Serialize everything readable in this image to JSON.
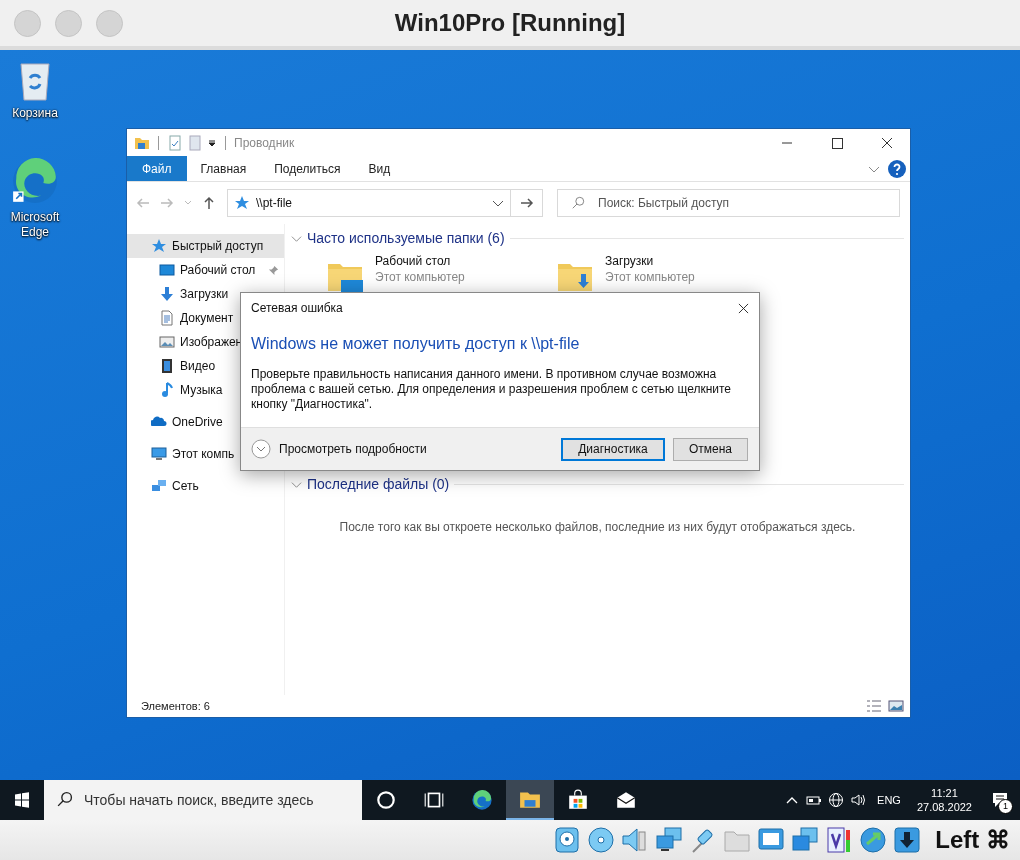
{
  "host_window": {
    "title": "Win10Pro [Running]"
  },
  "desktop_icons": [
    {
      "kind": "recycle-bin",
      "label": "Корзина"
    },
    {
      "kind": "edge",
      "label": "Microsoft Edge"
    }
  ],
  "explorer": {
    "title": "Проводник",
    "ribbon_tabs": [
      {
        "label": "Файл",
        "selected": true
      },
      {
        "label": "Главная",
        "selected": false
      },
      {
        "label": "Поделиться",
        "selected": false
      },
      {
        "label": "Вид",
        "selected": false
      }
    ],
    "address": "\\\\pt-file",
    "search": {
      "placeholder": "Поиск: Быстрый доступ"
    },
    "sidebar": [
      {
        "kind": "quick-access",
        "label": "Быстрый доступ",
        "selected": true,
        "children": [
          {
            "kind": "desktop",
            "label": "Рабочий стол",
            "selected": false,
            "pinned": true
          },
          {
            "kind": "downloads",
            "label": "Загрузки",
            "selected": false
          },
          {
            "kind": "documents",
            "label": "Документ",
            "selected": false
          },
          {
            "kind": "pictures",
            "label": "Изображен",
            "selected": false
          },
          {
            "kind": "videos",
            "label": "Видео",
            "selected": false
          },
          {
            "kind": "music",
            "label": "Музыка",
            "selected": false
          }
        ]
      },
      {
        "kind": "onedrive",
        "label": "OneDrive",
        "selected": false
      },
      {
        "kind": "computer",
        "label": "Этот компь",
        "selected": false
      },
      {
        "kind": "network",
        "label": "Сеть",
        "selected": false
      }
    ],
    "sections": [
      {
        "title": "Часто используемые папки (6)",
        "expanded": true,
        "folders": [
          {
            "kind": "desktop",
            "name": "Рабочий стол",
            "location": "Этот компьютер"
          },
          {
            "kind": "downloads",
            "name": "Загрузки",
            "location": "Этот компьютер"
          }
        ]
      },
      {
        "title": "Последние файлы (0)",
        "expanded": true,
        "empty_message": "После того как вы откроете несколько файлов, последние из них будут отображаться здесь."
      }
    ],
    "status": "Элементов: 6"
  },
  "dialog": {
    "title": "Сетевая ошибка",
    "heading": "Windows не может получить доступ к \\\\pt-file",
    "message": "Проверьте правильность написания данного имени. В противном случае возможна проблема с вашей сетью. Для определения и разрешения проблем с сетью щелкните кнопку \"Диагностика\".",
    "details": "Просмотреть подробности",
    "buttons": [
      {
        "label": "Диагностика",
        "default": true
      },
      {
        "label": "Отмена",
        "default": false
      }
    ]
  },
  "taskbar": {
    "search": {
      "placeholder": "Чтобы начать поиск, введите здесь"
    },
    "apps": [
      {
        "kind": "cortana",
        "selected": false
      },
      {
        "kind": "task-view",
        "selected": false
      },
      {
        "kind": "edge",
        "selected": false
      },
      {
        "kind": "explorer",
        "selected": true
      },
      {
        "kind": "store",
        "selected": false
      },
      {
        "kind": "mail",
        "selected": false
      }
    ],
    "language": "ENG",
    "time": "11:21",
    "date": "27.08.2022",
    "notifications": "1"
  },
  "vm_status_bar": {
    "host_key": "Left ⌘"
  }
}
